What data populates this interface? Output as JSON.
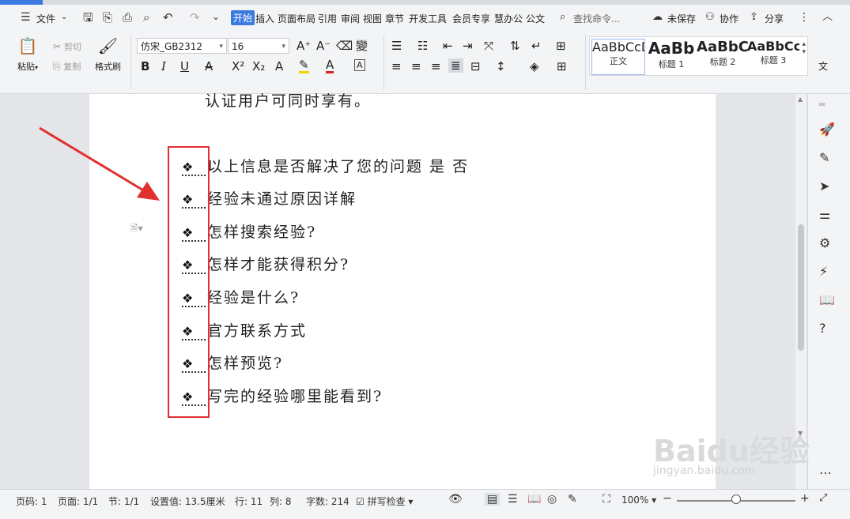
{
  "menubar": {
    "file": "文件",
    "tabs": [
      "开始",
      "插入",
      "页面布局",
      "引用",
      "审阅",
      "视图",
      "章节",
      "开发工具",
      "会员专享",
      "慧办公",
      "公文"
    ],
    "search_placeholder": "查找命令...",
    "unsaved": "未保存",
    "collab": "协作",
    "share": "分享"
  },
  "ribbon": {
    "paste": "粘贴",
    "cut": "剪切",
    "copy": "复制",
    "format_painter": "格式刷",
    "font_name": "仿宋_GB2312",
    "font_size": "16",
    "styles": [
      {
        "preview": "AaBbCcDd",
        "label": "正文"
      },
      {
        "preview": "AaBb",
        "label": "标题 1"
      },
      {
        "preview": "AaBbC",
        "label": "标题 2"
      },
      {
        "preview": "AaBbCc",
        "label": "标题 3"
      }
    ],
    "more": "文"
  },
  "document": {
    "top_line": "认证用户可同时享有。",
    "bullet_glyph": "❖",
    "items": [
      "以上信息是否解决了您的问题 是 否",
      "经验未通过原因详解",
      "怎样搜索经验?",
      "怎样才能获得积分?",
      "经验是什么?",
      "官方联系方式",
      "怎样预览?",
      "写完的经验哪里能看到?"
    ]
  },
  "status": {
    "page_num": "页码: 1",
    "pages": "页面: 1/1",
    "section": "节: 1/1",
    "setting": "设置值: 13.5厘米",
    "row": "行: 11",
    "col": "列: 8",
    "words": "字数: 214",
    "spell": "拼写检查",
    "zoom": "100%"
  },
  "watermark": {
    "main": "Baidu经验",
    "sub": "jingyan.baidu.com"
  },
  "colors": {
    "accent": "#3b7be0",
    "highlight_box": "#e03030"
  }
}
